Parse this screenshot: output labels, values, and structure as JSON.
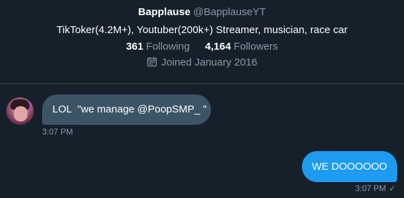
{
  "profile": {
    "display_name": "Bapplause",
    "handle": "@BapplauseYT",
    "bio": "TikToker(4.2M+), Youtuber(200k+) Streamer, musician, race car",
    "following_count": "361",
    "following_label": "Following",
    "followers_count": "4,164",
    "followers_label": "Followers",
    "joined_text": "Joined January 2016"
  },
  "messages": [
    {
      "direction": "incoming",
      "text": "LOL  \"we manage @PoopSMP_ \"",
      "time": "3:07 PM"
    },
    {
      "direction": "outgoing",
      "text": "WE DOOOOOO",
      "time": "3:07 PM",
      "status_icon": "check-icon"
    }
  ],
  "icons": {
    "joined": "calendar-icon",
    "avatar": "avatar"
  },
  "colors": {
    "background": "#15202b",
    "incoming_bubble": "#3d5466",
    "outgoing_bubble": "#1d9bf0",
    "secondary_text": "#8b98a5",
    "divider": "#38444d"
  }
}
